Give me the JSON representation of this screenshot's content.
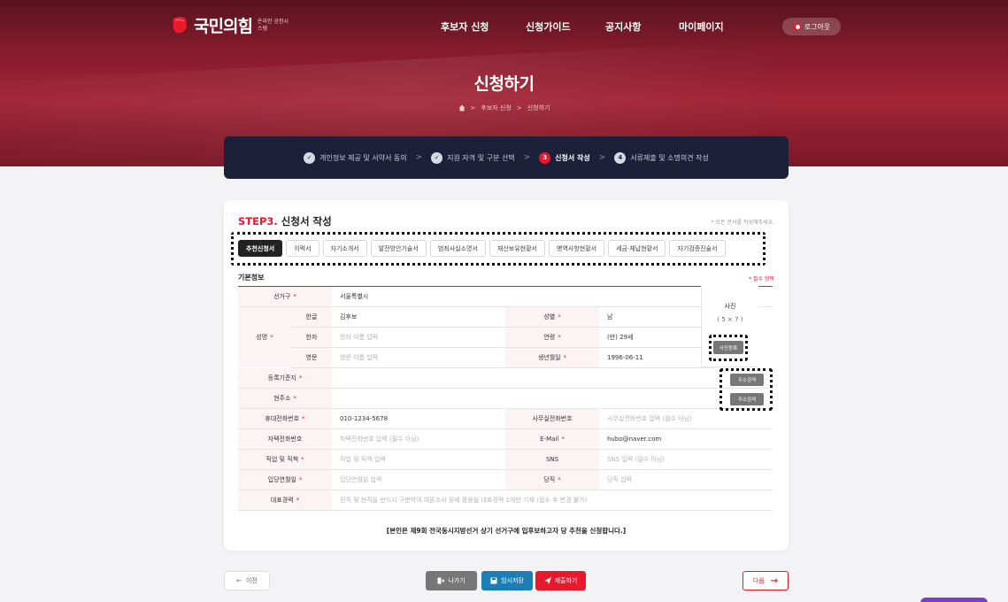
{
  "header": {
    "logo_title": "국민의힘",
    "logo_sub": "온라인 공천시스템",
    "nav": [
      "후보자 신청",
      "신청가이드",
      "공지사항",
      "마이페이지"
    ],
    "login_label": "로그아웃"
  },
  "hero": {
    "title": "신청하기",
    "breadcrumb": [
      "후보자 신청",
      "신청하기"
    ]
  },
  "steps": [
    {
      "label": "개인정보 제공 및 서약서 동의",
      "icon": "check-icon",
      "state": "done"
    },
    {
      "label": "지원 자격 및 구분 선택",
      "icon": "check-icon",
      "state": "done"
    },
    {
      "label": "신청서 작성",
      "number": "3",
      "state": "active"
    },
    {
      "label": "서류제출 및 소명의견 작성",
      "number": "4",
      "state": "pending"
    }
  ],
  "card": {
    "title_prefix": "STEP3.",
    "title_rest": " 신청서 작성",
    "note": "* 모든 문서를 작성해주세요.",
    "tabs": [
      "추천신청서",
      "이력서",
      "자기소개서",
      "발전방안기술서",
      "범죄사실소명서",
      "재산보유현황서",
      "병역사항현황서",
      "세금·체납현황서",
      "자기검증진술서"
    ],
    "active_tab": 0,
    "section": "기본정보",
    "required_note": "* 필수 항목"
  },
  "form": {
    "district_label": "선거구",
    "district_value": "서울특별시",
    "name_label": "성명",
    "hangul_label": "한글",
    "hangul_value": "김후보",
    "hanja_label": "한자",
    "hanja_placeholder": "한자 이름 입력",
    "english_label": "영문",
    "english_placeholder": "영문 이름 입력",
    "gender_label": "성별",
    "gender_value": "남",
    "age_label": "연령",
    "age_value": "(만) 29세",
    "birth_label": "생년월일",
    "birth_value": "1996-06-11",
    "photo_title": "사진",
    "photo_size": "( 5 × 7 )",
    "photo_button": "사진등록",
    "registered_label": "등록기준지",
    "address_label": "현주소",
    "address_button": "주소검색",
    "mobile_label": "휴대전화번호",
    "mobile_value": "010-1234-5678",
    "office_label": "사무실전화번호",
    "office_placeholder": "사무실전화번호 입력 (필수 아님)",
    "home_label": "자택전화번호",
    "home_placeholder": "자택전화번호 입력 (필수 아님)",
    "email_label": "E-Mail",
    "email_value": "hubo@naver.com",
    "job_label": "직업 및 직책",
    "job_placeholder": "직업 및 직책 입력",
    "sns_label": "SNS",
    "sns_placeholder": "SNS 입력 (필수 아님)",
    "party_date_label": "입당연월일",
    "party_date_placeholder": "입당연월일 입력",
    "party_role_label": "당직",
    "party_role_placeholder": "당직 입력",
    "career_label": "대표경력",
    "career_placeholder": "전직 및 현직을 반드시 구분하여 여론조사 등에 활용될 대표경력 1개만 기재 (접수 후 변경 불가)"
  },
  "declaration": "[본인은 제9회 전국동시지방선거 상기 선거구에 입후보하고자 당 추천을 신청합니다.]",
  "actions": {
    "prev": "이전",
    "exit": "나가기",
    "save": "임시저장",
    "submit": "제출하기",
    "next": "다음"
  },
  "colors": {
    "brand_red": "#e6192d",
    "navy": "#1c2039",
    "save_blue": "#1b7fb6"
  }
}
